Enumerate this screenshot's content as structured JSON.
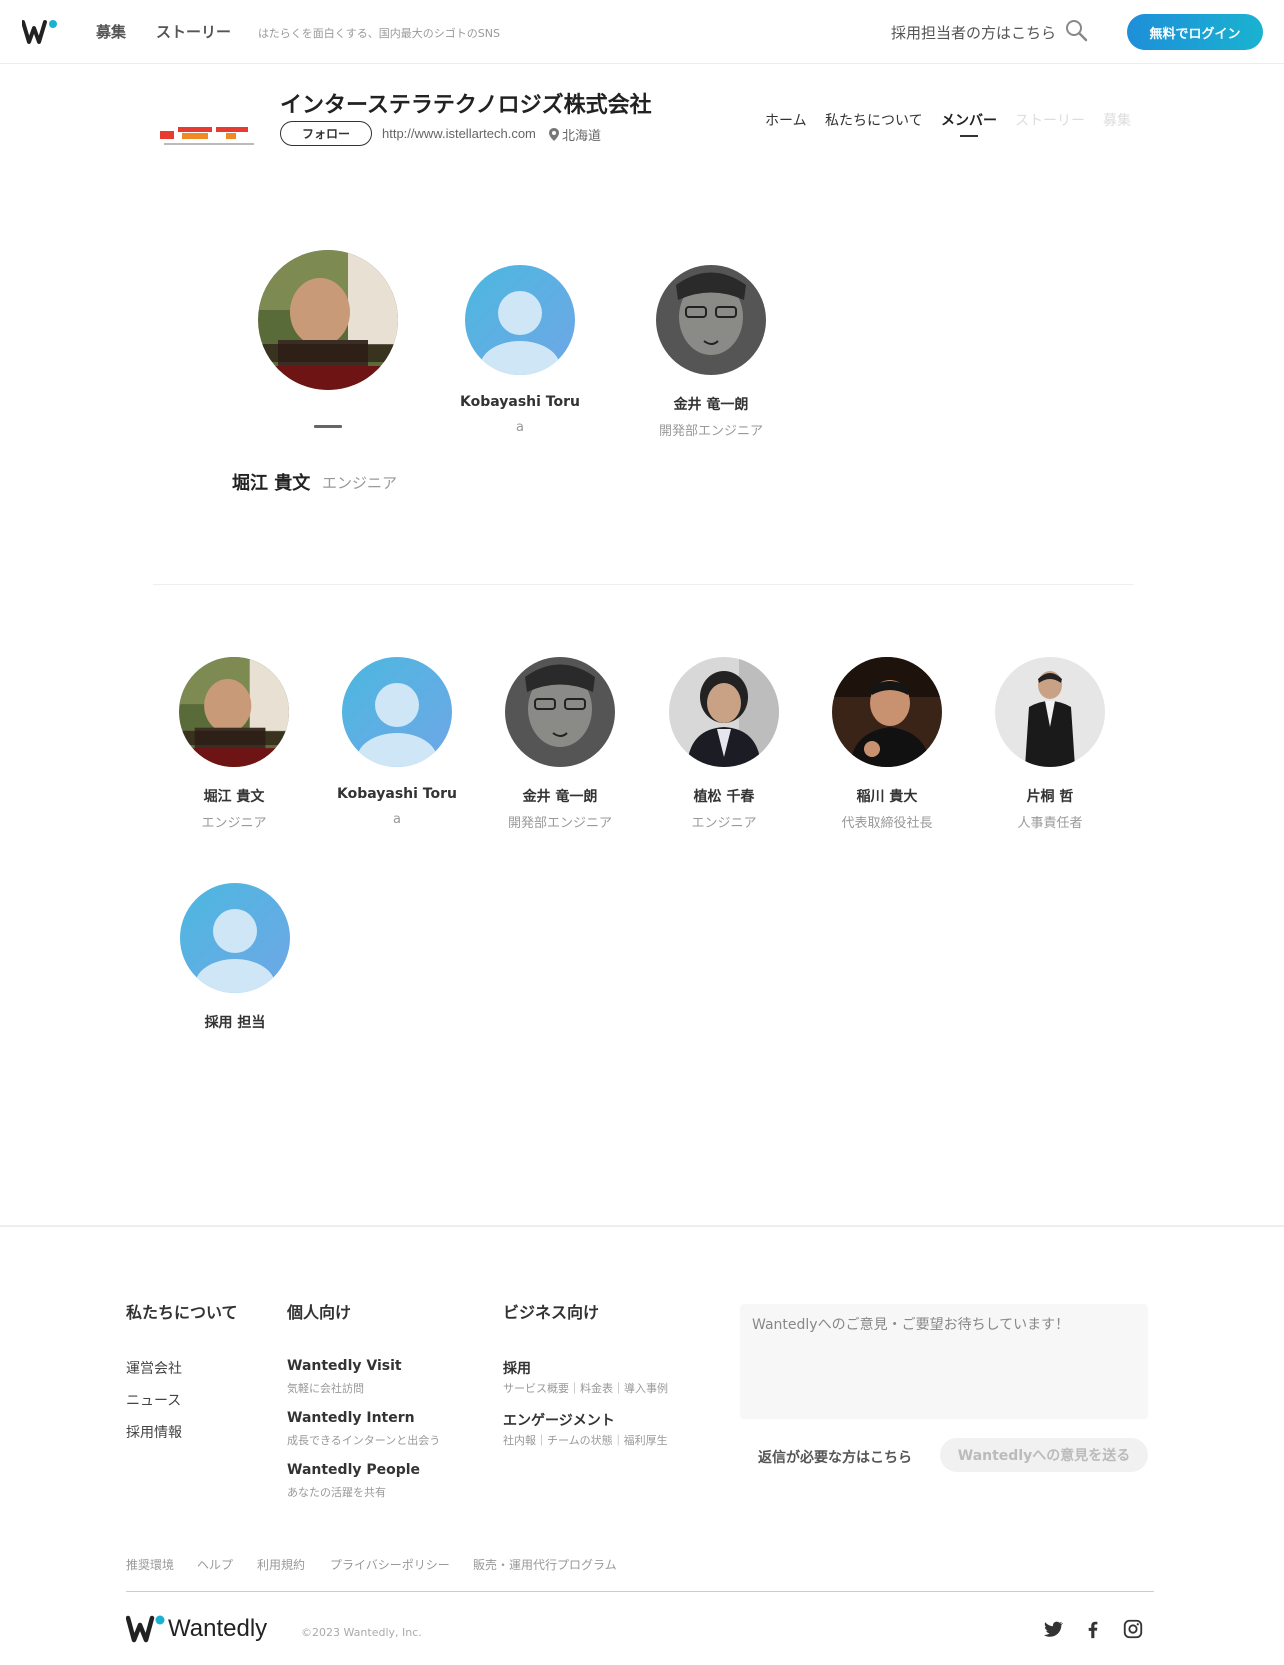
{
  "header": {
    "nav": [
      "募集",
      "ストーリー"
    ],
    "tagline": "はたらくを面白くする、国内最大のシゴトのSNS",
    "recruiter_link": "採用担当者の方はこちら",
    "login_label": "無料でログイン"
  },
  "company": {
    "name": "インターステラテクノロジズ株式会社",
    "follow_label": "フォロー",
    "url": "http://www.istellartech.com",
    "location": "北海道",
    "tabs": [
      "ホーム",
      "私たちについて",
      "メンバー",
      "ストーリー",
      "募集"
    ],
    "active_tab": "メンバー"
  },
  "featured": {
    "members": [
      {
        "name": "堀江 貴文",
        "role": "エンジニア"
      },
      {
        "name": "Kobayashi Toru",
        "role": "a"
      },
      {
        "name": "金井 竜一朗",
        "role": "開発部エンジニア"
      }
    ],
    "selected": {
      "name": "堀江 貴文",
      "role": "エンジニア"
    }
  },
  "members": [
    {
      "name": "堀江 貴文",
      "role": "エンジニア"
    },
    {
      "name": "Kobayashi Toru",
      "role": "a"
    },
    {
      "name": "金井 竜一朗",
      "role": "開発部エンジニア"
    },
    {
      "name": "植松 千春",
      "role": "エンジニア"
    },
    {
      "name": "稲川 貴大",
      "role": "代表取締役社長"
    },
    {
      "name": "片桐 哲",
      "role": "人事責任者"
    },
    {
      "name": "採用 担当",
      "role": ""
    }
  ],
  "footer": {
    "about_heading": "私たちについて",
    "about_links": [
      "運営会社",
      "ニュース",
      "採用情報"
    ],
    "personal_heading": "個人向け",
    "personal": [
      {
        "name": "Wantedly Visit",
        "desc": "気軽に会社訪問"
      },
      {
        "name": "Wantedly Intern",
        "desc": "成長できるインターンと出会う"
      },
      {
        "name": "Wantedly People",
        "desc": "あなたの活躍を共有"
      }
    ],
    "business_heading": "ビジネス向け",
    "business": [
      {
        "name": "採用",
        "desc": "サービス概要｜料金表｜導入事例"
      },
      {
        "name": "エンゲージメント",
        "desc": "社内報｜チームの状態｜福利厚生"
      }
    ],
    "feedback_placeholder": "Wantedlyへのご意見・ご要望お待ちしています！",
    "reply_link": "返信が必要な方はこちら",
    "send_label": "Wantedlyへの意見を送る",
    "legal": [
      "推奨環境",
      "ヘルプ",
      "利用規約",
      "プライバシーポリシー",
      "販売・運用代行プログラム"
    ],
    "brand": "Wantedly",
    "copyright": "©2023 Wantedly, Inc."
  },
  "colors": {
    "accent": "#1ab2d0",
    "login_gradient_start": "#1e8fd9",
    "default_avatar_start": "#4cb8e0",
    "default_avatar_end": "#6fa6e6"
  }
}
